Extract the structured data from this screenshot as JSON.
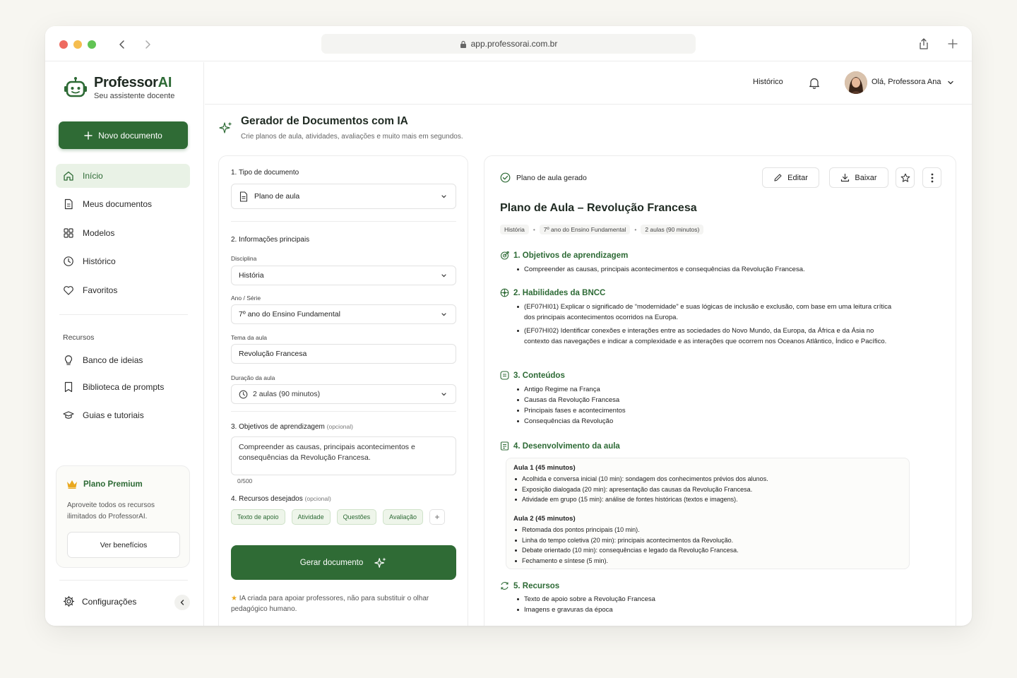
{
  "browser": {
    "url": "app.professorai.com.br"
  },
  "sidebar": {
    "brand_main": "Professor",
    "brand_accent": "AI",
    "brand_subtitle": "Seu assistente docente",
    "new_button": "Novo documento",
    "items": [
      {
        "label": "Início",
        "icon": "home-icon"
      },
      {
        "label": "Meus documentos",
        "icon": "document-icon"
      },
      {
        "label": "Modelos",
        "icon": "grid-icon"
      },
      {
        "label": "Histórico",
        "icon": "clock-icon"
      },
      {
        "label": "Favoritos",
        "icon": "heart-icon"
      }
    ],
    "section_label": "Recursos",
    "resources": [
      {
        "label": "Banco de ideias",
        "icon": "lightbulb-icon"
      },
      {
        "label": "Biblioteca de prompts",
        "icon": "bookmark-icon"
      },
      {
        "label": "Guias e tutoriais",
        "icon": "graduation-cap-icon"
      }
    ],
    "premium": {
      "title": "Plano Premium",
      "description": "Aproveite todos os recursos ilimitados do ProfessorAI.",
      "button": "Ver benefícios"
    },
    "settings": "Configurações"
  },
  "topbar": {
    "history": "Histórico",
    "greeting": "Olá, Professora Ana"
  },
  "header": {
    "title": "Gerador de Documentos com IA",
    "subtitle": "Crie planos de aula, atividades, avaliações e muito mais em segundos."
  },
  "form": {
    "doc_type_label": "1. Tipo de documento",
    "doc_type_value": "Plano de aula",
    "main_info_label": "2. Informações principais",
    "discipline_label": "Disciplina",
    "discipline_value": "História",
    "grade_label": "Ano / Série",
    "grade_value": "7º ano do Ensino Fundamental",
    "topic_label": "Tema da aula",
    "topic_value": "Revolução Francesa",
    "duration_label": "Duração da aula",
    "duration_value": "2 aulas (90 minutos)",
    "objectives_label": "3. Objetivos de aprendizagem",
    "optional": "(opcional)",
    "objectives_value": "Compreender as causas, principais acontecimentos e consequências da Revolução Francesa.",
    "counter": "0/500",
    "resources_label": "4. Recursos desejados",
    "chips": [
      "Texto de apoio",
      "Atividade",
      "Questões",
      "Avaliação"
    ],
    "chip_add": "+",
    "generate_button": "Gerar documento",
    "disclaimer_star": "★",
    "disclaimer": "IA criada para apoiar professores, não para substituir o olhar pedagógico humano."
  },
  "document": {
    "status": "Plano de aula gerado",
    "edit": "Editar",
    "download": "Baixar",
    "title": "Plano de Aula – Revolução Francesa",
    "tags": [
      "História",
      "7º ano do Ensino Fundamental",
      "2 aulas (90 minutos)"
    ],
    "tag_sep": "•",
    "sections": {
      "objectives": {
        "title": "1. Objetivos de aprendizagem",
        "items": [
          "Compreender as causas, principais acontecimentos e consequências da Revolução Francesa."
        ]
      },
      "bncc": {
        "title": "2. Habilidades da BNCC",
        "items": [
          "(EF07HI01) Explicar o significado de “modernidade” e suas lógicas de inclusão e exclusão, com base em uma leitura crítica dos principais acontecimentos ocorridos na Europa.",
          "(EF07HI02) Identificar conexões e interações entre as sociedades do Novo Mundo, da Europa, da África e da Ásia no contexto das navegações e indicar a complexidade e as interações que ocorrem nos Oceanos Atlântico, Índico e Pacífico."
        ]
      },
      "contents": {
        "title": "3. Conteúdos",
        "items": [
          "Antigo Regime na França",
          "Causas da Revolução Francesa",
          "Principais fases e acontecimentos",
          "Consequências da Revolução"
        ]
      },
      "development": {
        "title": "4. Desenvolvimento da aula",
        "aula1_title": "Aula 1 (45 minutos)",
        "aula1_items": [
          "Acolhida e conversa inicial (10 min): sondagem dos conhecimentos prévios dos alunos.",
          "Exposição dialogada (20 min): apresentação das causas da Revolução Francesa.",
          "Atividade em grupo (15 min): análise de fontes históricas (textos e imagens)."
        ],
        "aula2_title": "Aula 2 (45 minutos)",
        "aula2_items": [
          "Retomada dos pontos principais (10 min).",
          "Linha do tempo coletiva (20 min): principais acontecimentos da Revolução.",
          "Debate orientado (10 min): consequências e legado da Revolução Francesa.",
          "Fechamento e síntese (5 min)."
        ]
      },
      "resources": {
        "title": "5. Recursos",
        "items": [
          "Texto de apoio sobre a Revolução Francesa",
          "Imagens e gravuras da época"
        ]
      }
    }
  },
  "colors": {
    "accent": "#2f6b35",
    "accent_light": "#e9f2e6",
    "background": "#f7f6f1",
    "premium_crown": "#e9a81f"
  }
}
